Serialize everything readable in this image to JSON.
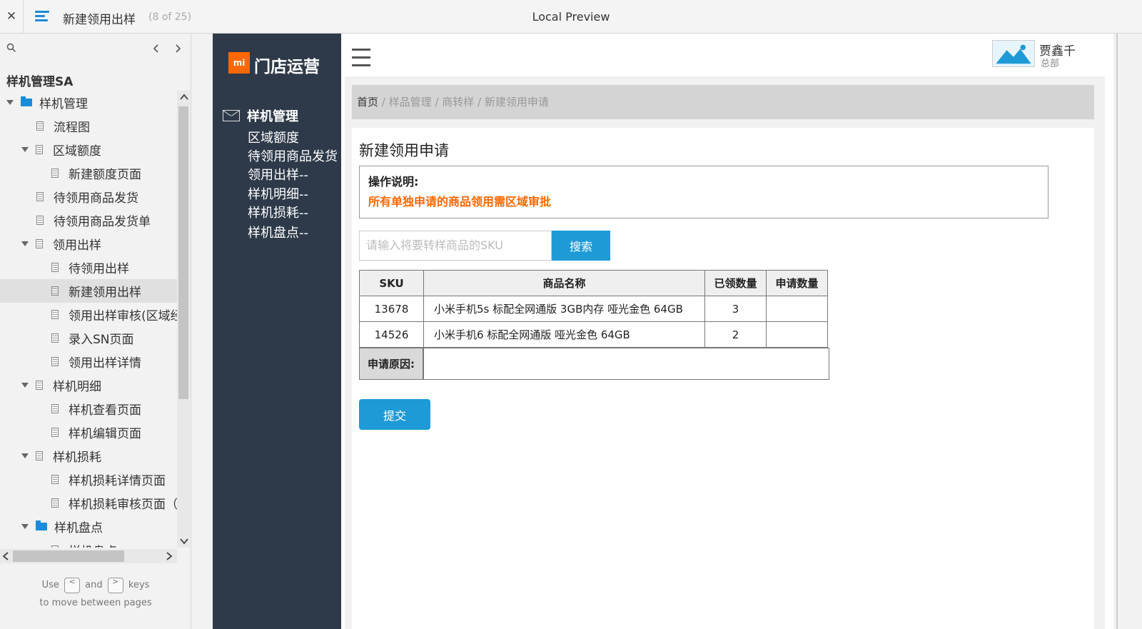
{
  "topbar": {
    "close_label": "✕",
    "page_name": "新建领用出样",
    "page_count": "(8 of 25)",
    "preview_title": "Local Preview"
  },
  "sidebar": {
    "root_label": "样机管理SA",
    "tree": [
      {
        "label": "样机管理",
        "kind": "folder",
        "expanded": true
      },
      {
        "label": "流程图",
        "kind": "page"
      },
      {
        "label": "区域额度",
        "kind": "page",
        "expanded": true
      },
      {
        "label": "新建额度页面",
        "kind": "page"
      },
      {
        "label": "待领用商品发货",
        "kind": "page"
      },
      {
        "label": "待领用商品发货单",
        "kind": "page"
      },
      {
        "label": "领用出样",
        "kind": "page",
        "expanded": true
      },
      {
        "label": "待领用出样",
        "kind": "page"
      },
      {
        "label": "新建领用出样",
        "kind": "page",
        "selected": true
      },
      {
        "label": "领用出样审核(区域经",
        "kind": "page"
      },
      {
        "label": "录入SN页面",
        "kind": "page"
      },
      {
        "label": "领用出样详情",
        "kind": "page"
      },
      {
        "label": "样机明细",
        "kind": "page",
        "expanded": true
      },
      {
        "label": "样机查看页面",
        "kind": "page"
      },
      {
        "label": "样机编辑页面",
        "kind": "page"
      },
      {
        "label": "样机损耗",
        "kind": "page",
        "expanded": true
      },
      {
        "label": "样机损耗详情页面",
        "kind": "page"
      },
      {
        "label": "样机损耗审核页面（",
        "kind": "page"
      },
      {
        "label": "样机盘点",
        "kind": "folder",
        "expanded": true
      },
      {
        "label": "样机盘点",
        "kind": "page"
      }
    ],
    "help": {
      "use": "Use",
      "key_prev": "<",
      "and": "and",
      "key_next": ">",
      "keys": "keys",
      "line2": "to move between pages"
    }
  },
  "app": {
    "logo_mark": "mi",
    "logo_text": "门店运营",
    "nav_group": "样机管理",
    "nav_items": [
      "区域额度",
      "待领用商品发货",
      "领用出样--",
      "样机明细--",
      "样机损耗--",
      "样机盘点--"
    ],
    "user_name": "贾鑫千",
    "user_dept": "总部",
    "breadcrumb": {
      "home": "首页",
      "sep": " / ",
      "items": [
        "样品管理",
        "商转样",
        "新建领用申请"
      ]
    },
    "page_title": "新建领用申请",
    "notice_label": "操作说明:",
    "notice_text": "所有单独申请的商品领用需区域审批",
    "search_placeholder": "请输入将要转样商品的SKU",
    "search_button": "搜索",
    "table": {
      "headers": [
        "SKU",
        "商品名称",
        "已领数量",
        "申请数量"
      ],
      "rows": [
        [
          "13678",
          "小米手机5s 标配全网通版 3GB内存 哑光金色 64GB",
          "3",
          ""
        ],
        [
          "14526",
          "小米手机6 标配全网通版  哑光金色 64GB",
          "2",
          ""
        ]
      ]
    },
    "reason_label": "申请原因:",
    "submit_button": "提交"
  },
  "colors": {
    "brand_orange": "#ff6700",
    "primary_blue": "#1e9ad6",
    "sidebar_dark": "#2e3a49",
    "tree_accent": "#1a8bd8"
  }
}
